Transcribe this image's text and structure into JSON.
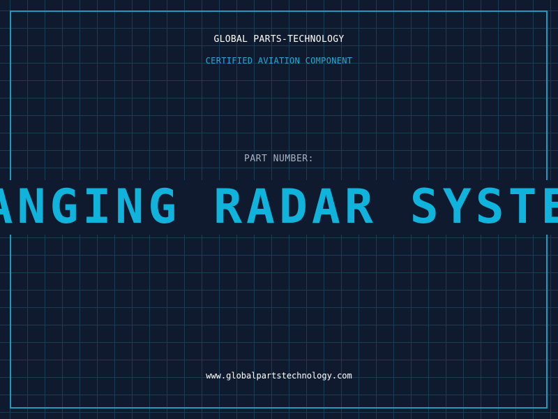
{
  "header": {
    "company": "GLOBAL PARTS-TECHNOLOGY",
    "tagline": "CERTIFIED AVIATION COMPONENT"
  },
  "part": {
    "label": "PART NUMBER:",
    "value": "RANGING RADAR SYSTEM"
  },
  "footer": {
    "url": "www.globalpartstechnology.com"
  },
  "colors": {
    "background": "#101a2e",
    "grid": "#1b3c55",
    "frame": "#1e9ac0",
    "accent": "#0fb3dc"
  }
}
